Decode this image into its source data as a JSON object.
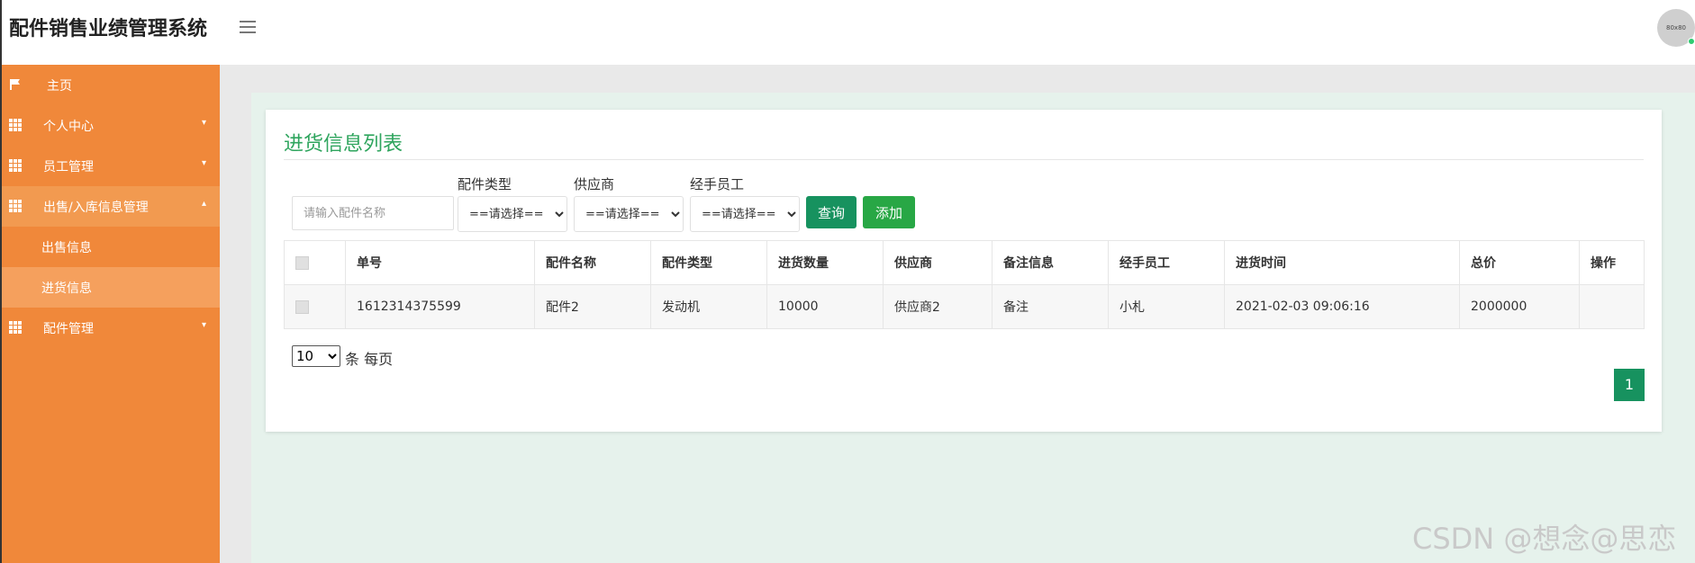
{
  "app": {
    "title": "配件销售业绩管理系统",
    "avatar_text": "80x80"
  },
  "sidebar": {
    "items": [
      {
        "label": "主页",
        "icon": "flag-icon"
      },
      {
        "label": "个人中心",
        "icon": "grid-icon"
      },
      {
        "label": "员工管理",
        "icon": "grid-icon"
      },
      {
        "label": "出售/入库信息管理",
        "icon": "grid-icon"
      },
      {
        "label": "出售信息"
      },
      {
        "label": "进货信息"
      },
      {
        "label": "配件管理",
        "icon": "grid-icon"
      }
    ]
  },
  "page": {
    "title": "进货信息列表"
  },
  "filters": {
    "search_placeholder": "请输入配件名称",
    "type_label": "配件类型",
    "supplier_label": "供应商",
    "employee_label": "经手员工",
    "select_default": "==请选择==",
    "query_button": "查询",
    "add_button": "添加"
  },
  "table": {
    "headers": [
      "单号",
      "配件名称",
      "配件类型",
      "进货数量",
      "供应商",
      "备注信息",
      "经手员工",
      "进货时间",
      "总价",
      "操作"
    ],
    "rows": [
      [
        "1612314375599",
        "配件2",
        "发动机",
        "10000",
        "供应商2",
        "备注",
        "小札",
        "2021-02-03 09:06:16",
        "2000000",
        ""
      ]
    ]
  },
  "pagination": {
    "page_size": "10",
    "page_size_label": "条 每页",
    "current_page": "1"
  },
  "watermark": "CSDN @想念@思恋"
}
